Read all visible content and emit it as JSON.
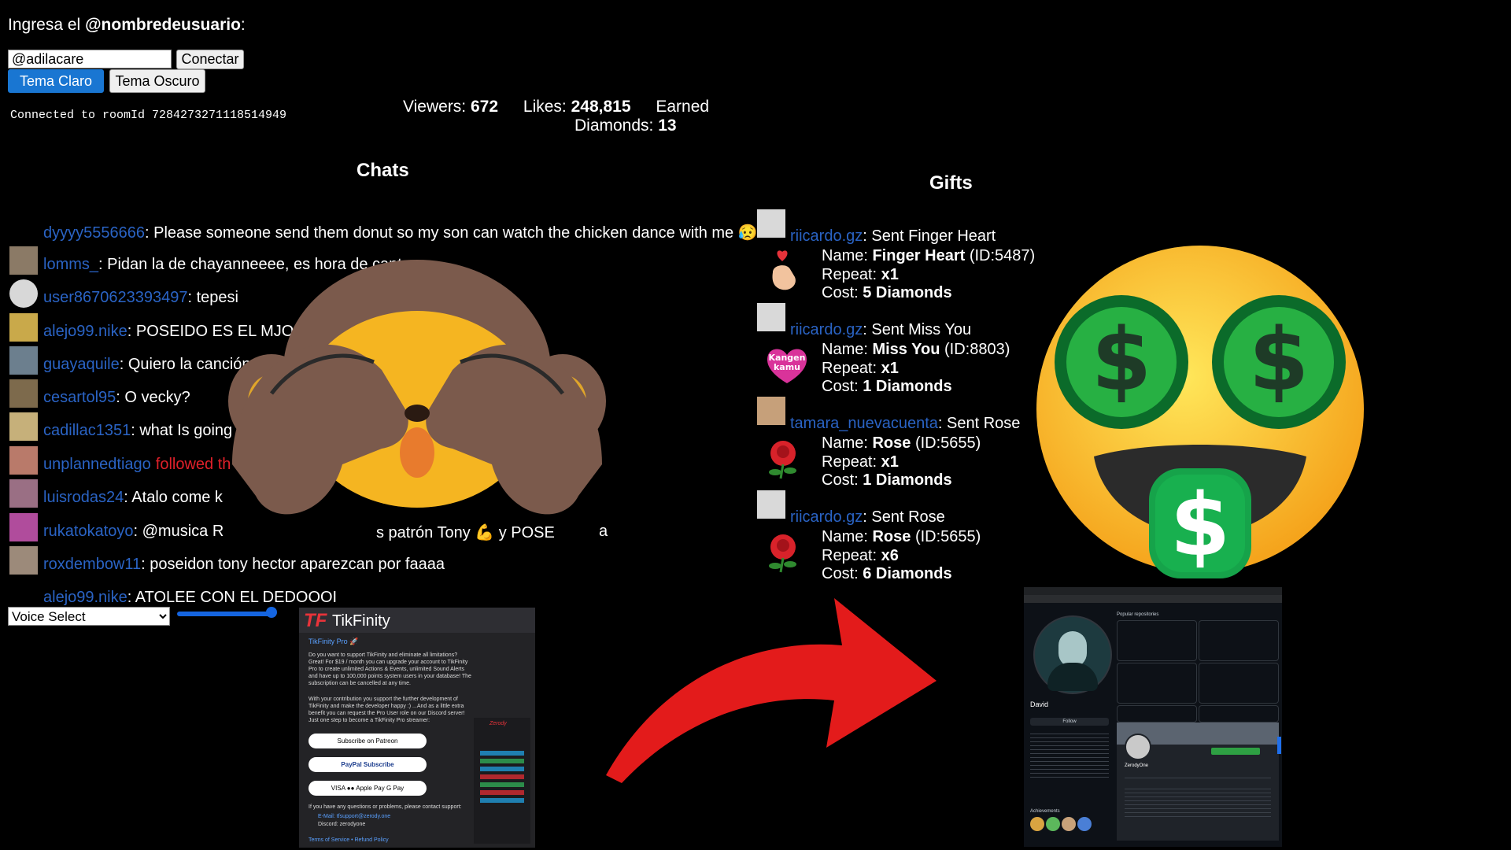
{
  "header": {
    "prompt_prefix": "Ingresa el ",
    "prompt_bold": "@nombredeusuario",
    "prompt_suffix": ":",
    "username_value": "@adilacare",
    "connect_label": "Conectar",
    "light_theme_label": "Tema Claro",
    "dark_theme_label": "Tema Oscuro",
    "status": "Connected to roomId 7284273271118514949"
  },
  "stats": {
    "viewers_label": "Viewers:",
    "viewers": "672",
    "likes_label": "Likes:",
    "likes": "248,815",
    "earned_label": "Earned",
    "diamonds_label": "Diamonds:",
    "diamonds": "13"
  },
  "chats": {
    "title": "Chats",
    "messages": [
      {
        "user": "dyyyy5556666",
        "text": ": Please someone send them donut so my son can watch the chicken dance with me 😥"
      },
      {
        "user": "lomms_",
        "text": ": Pidan la de chayanneeee, es hora de cantar"
      },
      {
        "user": "user8670623393497",
        "text": ": tepesi"
      },
      {
        "user": "alejo99.nike",
        "text": ": POSEIDO ES EL MJOR"
      },
      {
        "user": "guayaquile",
        "text": ": Quiero la canción feliz,"
      },
      {
        "user": "cesartol95",
        "text": ": O vecky?"
      },
      {
        "user": "cadillac1351",
        "text": ": what Is going on"
      },
      {
        "user": "unplannedtiago",
        "text": "followed th"
      },
      {
        "user": "luisrodas24",
        "text": ": Atalo come k"
      },
      {
        "user": "rukatokatoyo",
        "text": ": @musica R"
      },
      {
        "user": "roxdembow11",
        "text": ": poseidon tony hector aparezcan por faaaa"
      },
      {
        "user": "alejo99.nike",
        "text": ": ATOLEE CON EL DEDOOOI"
      }
    ],
    "partial_text": "s patrón Tony 💪 y POSE",
    "partial_tail": "a"
  },
  "gifts": {
    "title": "Gifts",
    "items": [
      {
        "user": "riicardo.gz",
        "action": ": Sent Finger Heart",
        "name": "Finger Heart",
        "id": "(ID:5487)",
        "repeat": "x1",
        "cost": "5 Diamonds"
      },
      {
        "user": "riicardo.gz",
        "action": ": Sent Miss You",
        "name": "Miss You",
        "id": "(ID:8803)",
        "repeat": "x1",
        "cost": "1 Diamonds"
      },
      {
        "user": "tamara_nuevacuenta",
        "action": ": Sent Rose",
        "name": "Rose",
        "id": "(ID:5655)",
        "repeat": "x1",
        "cost": "1 Diamonds"
      },
      {
        "user": "riicardo.gz",
        "action": ": Sent Rose",
        "name": "Rose",
        "id": "(ID:5655)",
        "repeat": "x6",
        "cost": "6 Diamonds"
      }
    ],
    "labels": {
      "name": "Name:",
      "repeat": "Repeat:",
      "cost": "Cost:"
    },
    "kangen_text": "Kangen kamu"
  },
  "controls": {
    "voice_select": "Voice Select",
    "slider_value": 0.75
  },
  "tikfinity": {
    "logo_mark": "TF",
    "brand": "TikFinity",
    "pro_title": "TikFinity Pro 🚀",
    "para1": "Do you want to support TikFinity and eliminate all limitations? Great! For $19 / month you can upgrade your account to TikFinity Pro to create unlimited Actions & Events, unlimited Sound Alerts and have up to 100,000 points system users in your database! The subscription can be cancelled at any time.",
    "para2": "With your contribution you support the further development of TikFinity and make the developer happy :) ...And as a little extra benefit you can request the Pro User role on our Discord server! Just one step to become a TikFinity Pro streamer:",
    "patreon": "Subscribe on Patreon",
    "paypal": "PayPal Subscribe",
    "cards": "VISA  ●●  Apple Pay  G Pay",
    "contact": "If you have any questions or problems, please contact support:",
    "email": "E-Mail: tfsupport@zerody.one",
    "discord": "Discord: zerodyone",
    "footer": "Terms of Service • Refund Policy",
    "side_name": "Zerody"
  },
  "github": {
    "name": "David",
    "section": "Popular repositories",
    "profile_name": "ZerodyOne",
    "follow": "Follow",
    "achievements": "Achievements"
  },
  "colors": {
    "link": "#2a63c4",
    "followed": "#e0202a",
    "theme_blue": "#1976d2",
    "slider": "#1565e0"
  }
}
